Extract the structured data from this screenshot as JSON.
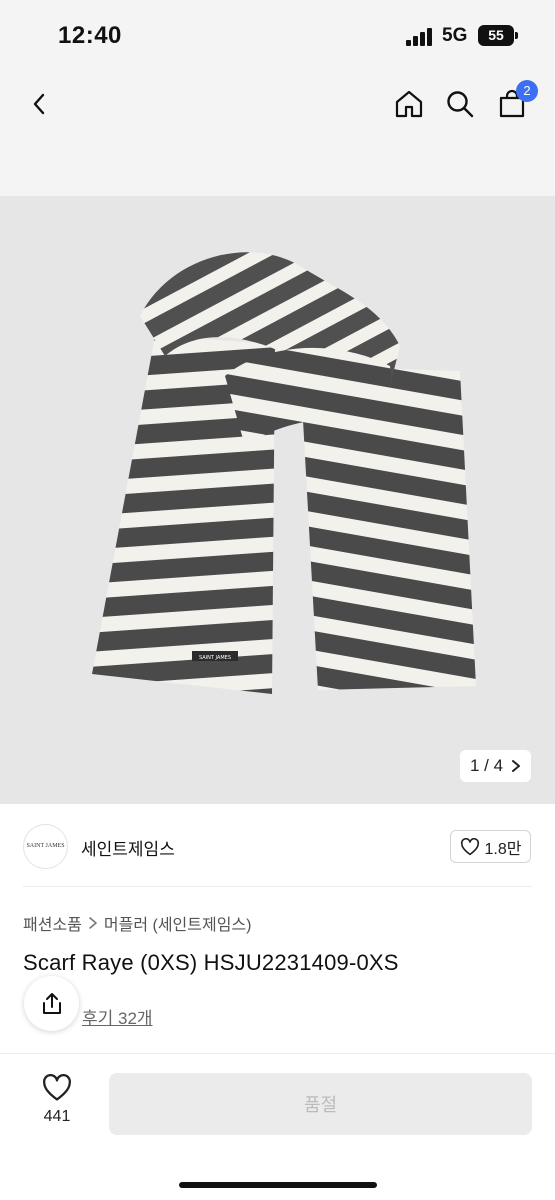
{
  "status": {
    "time": "12:40",
    "network": "5G",
    "battery": "55"
  },
  "nav": {
    "cart_count": "2"
  },
  "gallery": {
    "current": "1",
    "total": "4",
    "pager_text": "1 / 4",
    "scarf_label": "SAINT JAMES"
  },
  "brand": {
    "name": "세인트제임스",
    "logo_text": "SAINT JAMES",
    "likes": "1.8만"
  },
  "breadcrumb": {
    "category": "패션소품",
    "subcategory": "머플러 (세인트제임스)"
  },
  "product": {
    "title": "Scarf Raye (0XS) HSJU2231409-0XS",
    "reviews": "후기 32개"
  },
  "bottom": {
    "wish_count": "441",
    "action_label": "품절"
  },
  "colors": {
    "accent": "#3d6ff2",
    "stripe_dark": "#4a4a4a",
    "stripe_light": "#f3f1ec"
  }
}
